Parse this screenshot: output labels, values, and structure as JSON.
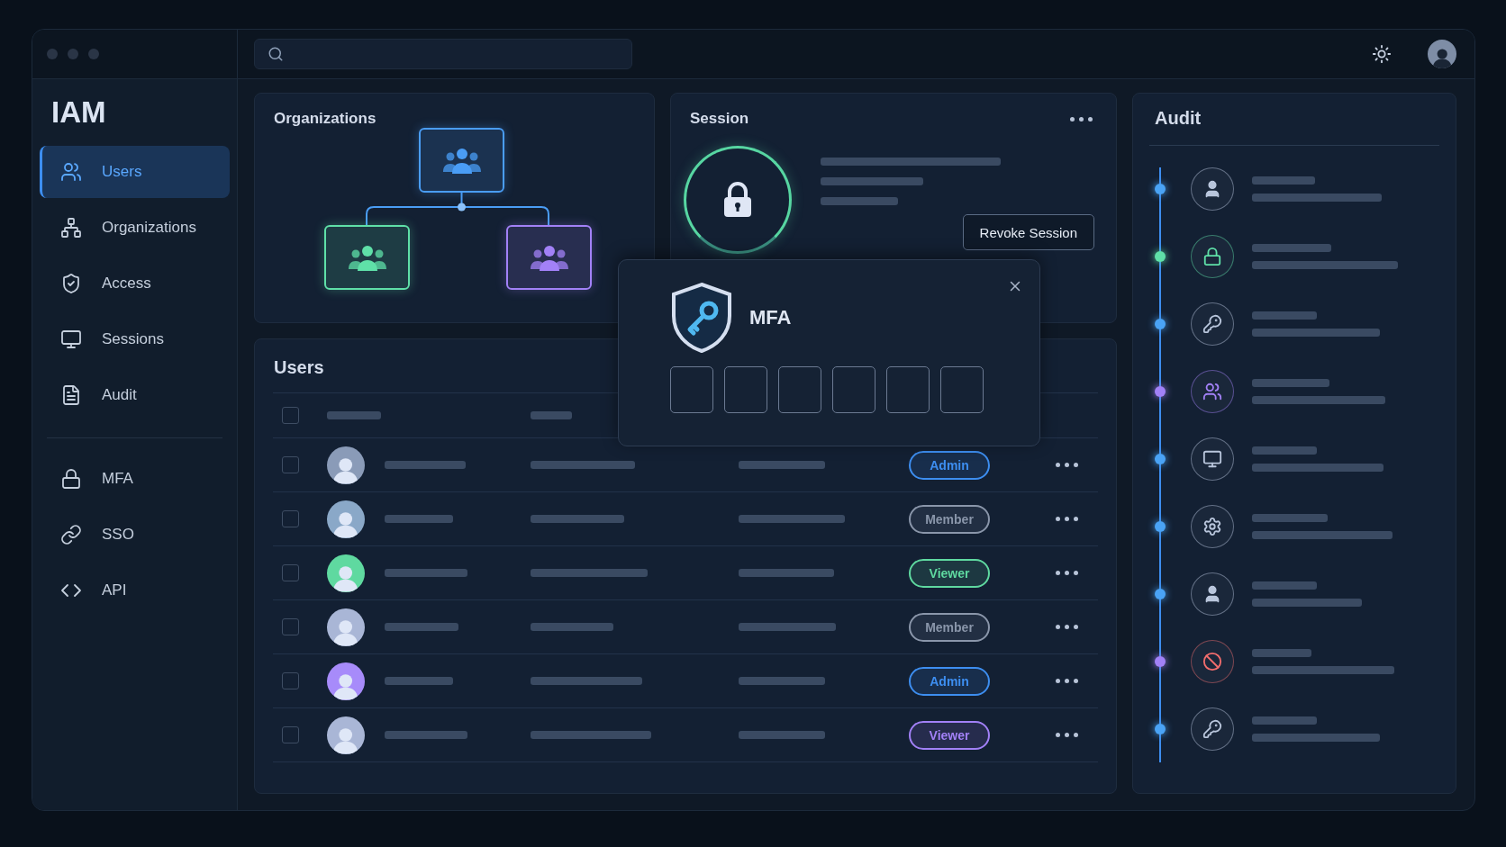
{
  "sidebar": {
    "title": "IAM",
    "items": [
      {
        "label": "Users",
        "kind": "users",
        "selected": true
      },
      {
        "label": "Organizations",
        "kind": "network",
        "selected": false
      },
      {
        "label": "Access",
        "kind": "shield",
        "selected": false
      },
      {
        "label": "Sessions",
        "kind": "monitor",
        "selected": false
      },
      {
        "label": "Audit",
        "kind": "file",
        "selected": false
      }
    ],
    "secondary_items": [
      {
        "label": "MFA",
        "kind": "lock",
        "selected": false
      },
      {
        "label": "SSO",
        "kind": "link",
        "selected": false
      },
      {
        "label": "API",
        "kind": "code",
        "selected": false
      }
    ]
  },
  "organizations": {
    "title": "Organizations",
    "nodes": [
      {
        "color": "#4a9df5"
      },
      {
        "color": "#5fe0a8"
      },
      {
        "color": "#a281f7"
      }
    ]
  },
  "session": {
    "title": "Session",
    "button": "Revoke Session"
  },
  "mfa_dialog": {
    "title": "MFA"
  },
  "users": {
    "title": "Users",
    "select_all_checked": false,
    "rows": [
      {
        "checked": false,
        "avatar": {
          "color": "#8a9bb8"
        },
        "role": {
          "label": "Admin",
          "color": "#3d8ef0"
        }
      },
      {
        "checked": false,
        "avatar": {
          "color": "#8aa8c8"
        },
        "role": {
          "label": "Member",
          "color": "#8a96aa"
        }
      },
      {
        "checked": false,
        "avatar": {
          "color": "#5fd9a0"
        },
        "role": {
          "label": "Viewer",
          "color": "#5fd9a0"
        }
      },
      {
        "checked": false,
        "avatar": {
          "color": "#a9b6d6"
        },
        "role": {
          "label": "Member",
          "color": "#8a96aa"
        }
      },
      {
        "checked": false,
        "avatar": {
          "color": "#a78bfa"
        },
        "role": {
          "label": "Admin",
          "color": "#3d8ef0"
        }
      },
      {
        "checked": false,
        "avatar": {
          "color": "#a9b6d6"
        },
        "role": {
          "label": "Viewer",
          "color": "#a281f7"
        }
      }
    ]
  },
  "audit": {
    "title": "Audit",
    "events": [
      {
        "kind": "user",
        "color": "#4aa3f5"
      },
      {
        "kind": "lock",
        "color": "#5fe0a8"
      },
      {
        "kind": "key",
        "color": "#4aa3f5"
      },
      {
        "kind": "group",
        "color": "#a281f7"
      },
      {
        "kind": "monitor",
        "color": "#4aa3f5"
      },
      {
        "kind": "gear",
        "color": "#4aa3f5"
      },
      {
        "kind": "user",
        "color": "#4aa3f5"
      },
      {
        "kind": "blocked",
        "color": "#a281f7"
      },
      {
        "kind": "key",
        "color": "#4aa3f5"
      }
    ]
  }
}
